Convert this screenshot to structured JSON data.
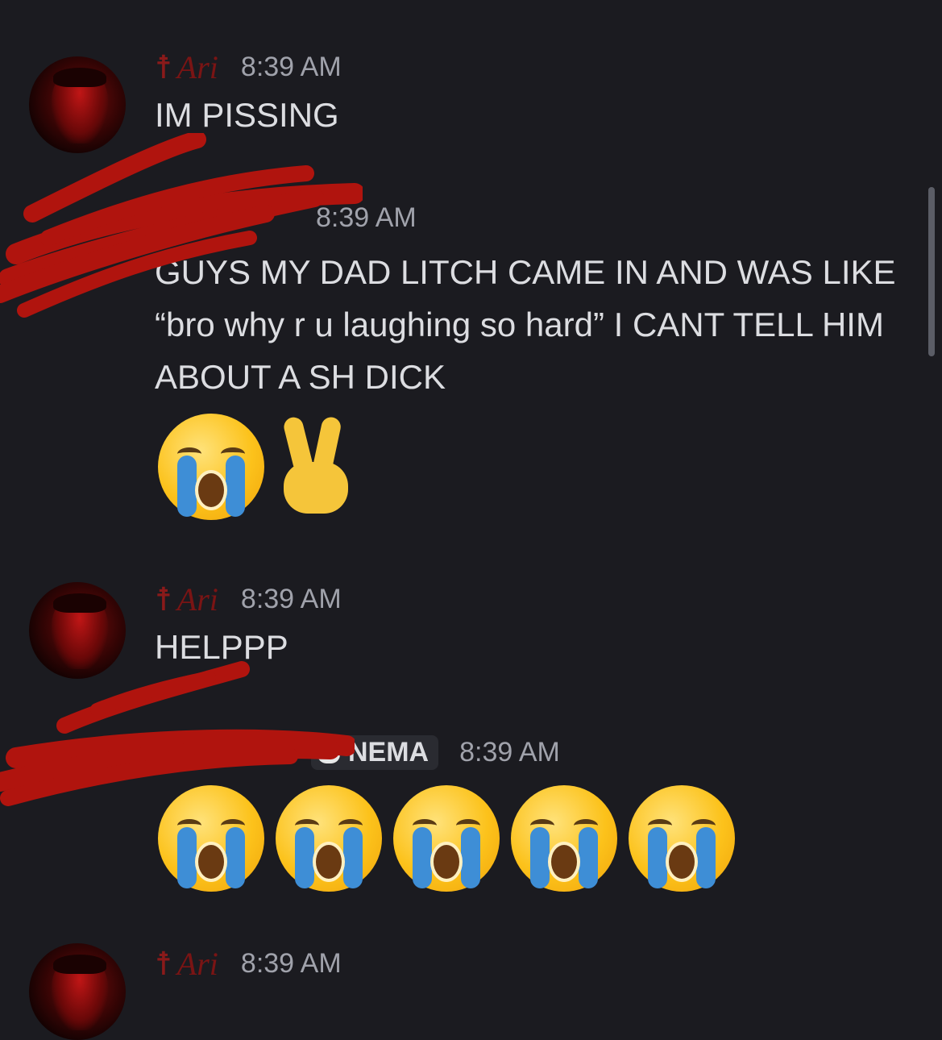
{
  "messages": [
    {
      "author": "Ari",
      "time": "8:39 AM",
      "text": "IM PISSING"
    },
    {
      "author": "",
      "time": "8:39 AM",
      "text": "GUYS MY DAD LITCH CAME IN AND WAS LIKE “bro why r u laughing so hard” I CANT TELL HIM ABOUT A SH DICK",
      "emoji": [
        "loudly-crying-face",
        "victory-hand"
      ]
    },
    {
      "author": "Ari",
      "time": "8:39 AM",
      "text": "HELPPP"
    },
    {
      "author": "",
      "tag": "NEMA",
      "time": "8:39 AM",
      "emoji": [
        "loudly-crying-face",
        "loudly-crying-face",
        "loudly-crying-face",
        "loudly-crying-face",
        "loudly-crying-face"
      ]
    },
    {
      "author": "Ari",
      "time": "8:39 AM"
    }
  ],
  "colors": {
    "background": "#1b1b20",
    "text": "#dcdde1",
    "author_ari": "#7a1414",
    "timestamp": "#a0a2ab",
    "redaction": "#b0140e"
  }
}
